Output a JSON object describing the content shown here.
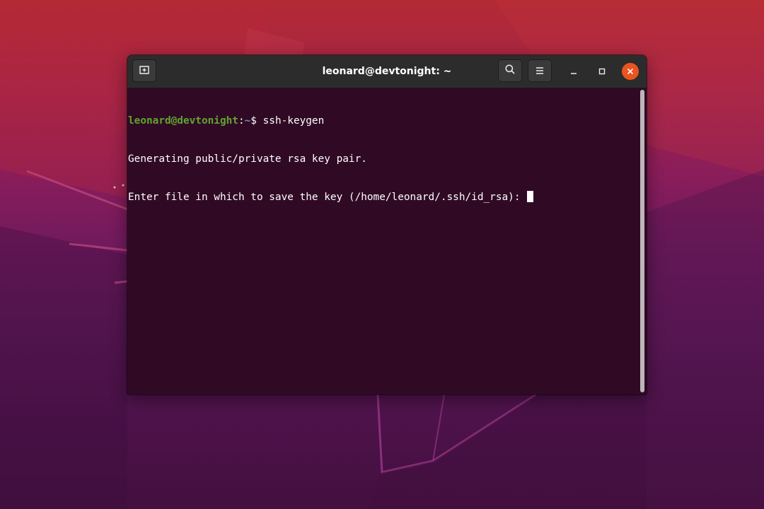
{
  "window": {
    "title": "leonard@devtonight: ~"
  },
  "header_bar": {
    "new_tab_icon": "new-tab-icon",
    "search_icon": "search-icon",
    "menu_icon": "hamburger-menu-icon",
    "minimize_icon": "minimize-icon",
    "maximize_icon": "maximize-icon",
    "close_icon": "close-icon"
  },
  "terminal": {
    "prompt_user_host": "leonard@devtonight",
    "prompt_sep": ":",
    "prompt_path": "~",
    "prompt_symbol": "$ ",
    "command": "ssh-keygen",
    "output_lines": [
      "Generating public/private rsa key pair.",
      "Enter file in which to save the key (/home/leonard/.ssh/id_rsa): "
    ]
  },
  "colors": {
    "terminal_bg": "#300a24",
    "prompt_user": "#5fa530",
    "prompt_path": "#6e8fd6",
    "close_button": "#e95420",
    "header_bg": "#2c2c2c"
  }
}
